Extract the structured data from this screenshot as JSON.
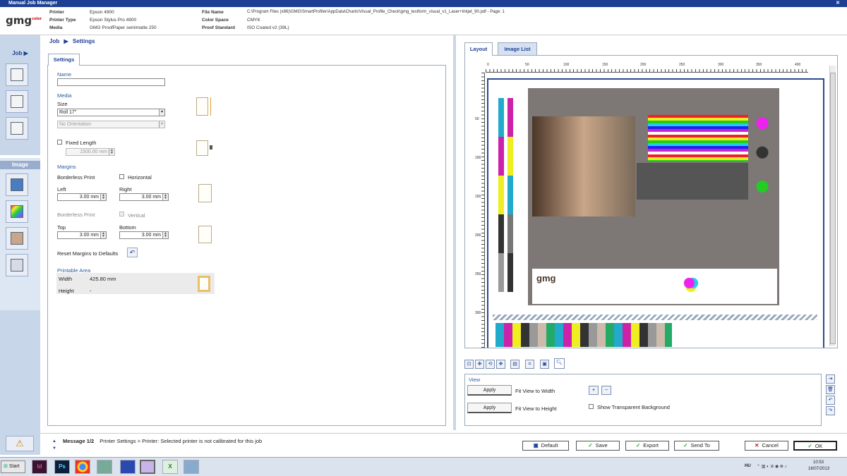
{
  "window": {
    "title": "Manual Job Manager"
  },
  "header": {
    "logo": "gmg",
    "logo_sup": "color",
    "printer_label": "Printer",
    "printer_value": "Epson 4900",
    "printer_type_label": "Printer Type",
    "printer_type_value": "Epson Stylus Pro 4900",
    "media_label": "Media",
    "media_value": "GMG ProofPaper semimatte 250",
    "file_name_label": "File Name",
    "file_name_value": "C:\\Program Files (x86)\\GMG\\SmartProfiler\\AppData\\Charts\\Visual_Profile_Check\\gmg_testform_visual_v1_Laser+Inkjet_90.pdf - Page: 1",
    "color_space_label": "Color Space",
    "color_space_value": "CMYK",
    "proof_standard_label": "Proof Standard",
    "proof_standard_value": "ISO Coated v2 (39L)"
  },
  "leftbar": {
    "job_label": "Job",
    "image_label": "Image"
  },
  "breadcrumb": {
    "job": "Job",
    "settings": "Settings"
  },
  "settings": {
    "tab": "Settings",
    "name_label": "Name",
    "name_value": "",
    "media_section": "Media",
    "size_label": "Size",
    "size_value": "Roll 17\"",
    "orientation_value": "No Orientation",
    "fixed_length_label": "Fixed Length",
    "fixed_length_value": "1500.00 mm",
    "margins_section": "Margins",
    "borderless_print_1": "Borderless Print",
    "horizontal_label": "Horizontal",
    "left_label": "Left",
    "left_value": "3.00 mm",
    "right_label": "Right",
    "right_value": "3.00 mm",
    "borderless_print_2": "Borderless Print",
    "vertical_label": "Vertical",
    "top_label": "Top",
    "top_value": "3.00 mm",
    "bottom_label": "Bottom",
    "bottom_value": "3.00 mm",
    "reset_label": "Reset Margins to Defaults",
    "printable_section": "Printable Area",
    "width_label": "Width",
    "width_value": "425.80 mm",
    "height_label": "Height",
    "height_value": "-"
  },
  "right_tabs": {
    "layout": "Layout",
    "image_list": "Image List"
  },
  "ruler": {
    "h": [
      "0",
      "50",
      "100",
      "150",
      "200",
      "250",
      "300",
      "350",
      "400"
    ],
    "v": [
      "50",
      "100",
      "150",
      "200",
      "250",
      "300"
    ]
  },
  "preview": {
    "brand": "gmg"
  },
  "view": {
    "section": "View",
    "apply_1": "Apply",
    "fit_width": "Fit View to Width",
    "apply_2": "Apply",
    "fit_height": "Fit View to Height",
    "show_transparent": "Show Transparent Background"
  },
  "status": {
    "message_num": "Message 1/2",
    "message_text": "Printer Settings > Printer: Selected printer is not calibrated for this job"
  },
  "buttons": {
    "default": "Default",
    "save": "Save",
    "export": "Export",
    "send_to": "Send To",
    "cancel": "Cancel",
    "ok": "OK"
  },
  "taskbar": {
    "start": "Start",
    "lang": "HU",
    "time": "10:53",
    "date": "16/07/2013"
  },
  "colors": {
    "accent": "#1c3f94",
    "sidebar": "#c8d6ea",
    "ok_check": "#2a9a2a",
    "cancel_x": "#c01818"
  }
}
